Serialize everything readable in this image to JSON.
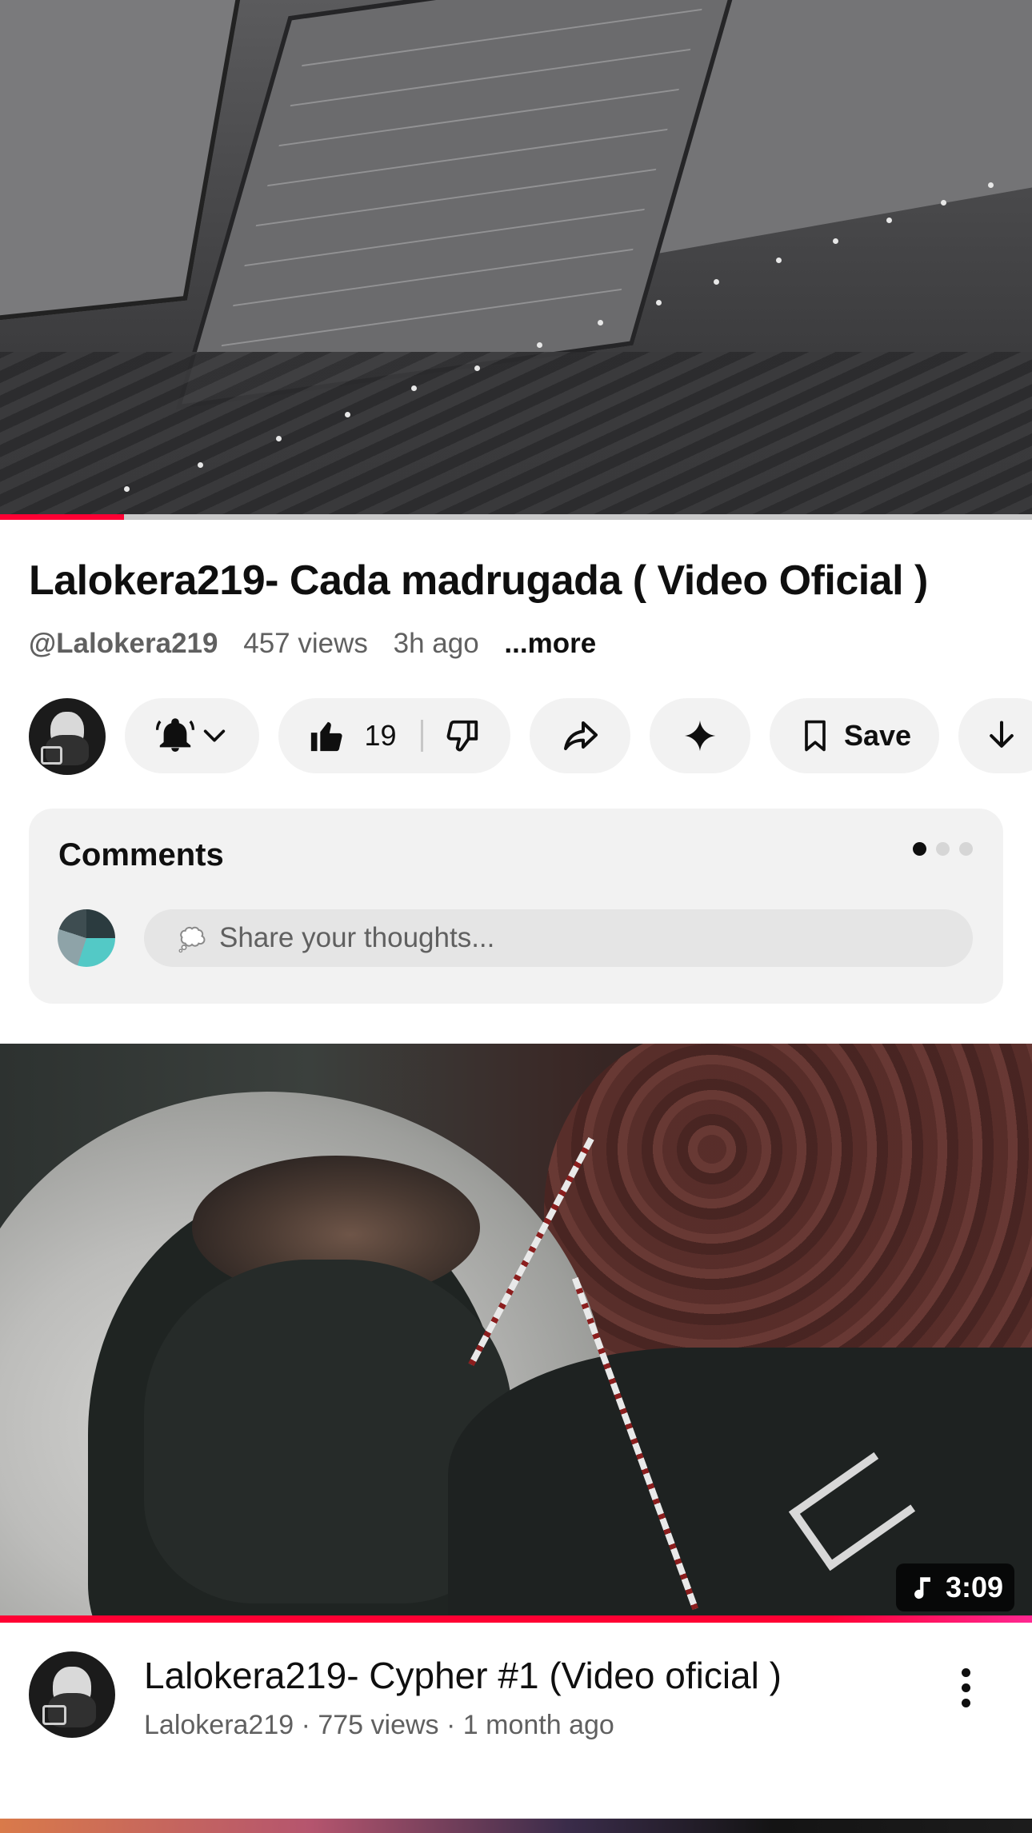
{
  "player": {
    "progress_fraction": 0.12,
    "progress_color": "#ff0033"
  },
  "video": {
    "title": "Lalokera219- Cada madrugada ( Video Oficial )",
    "handle": "@Lalokera219",
    "views": "457 views",
    "age": "3h ago",
    "more": "...more"
  },
  "actions": {
    "subscribe_icon": "bell-icon",
    "likes": "19",
    "save_label": "Save",
    "icons": [
      "thumbs-up-icon",
      "thumbs-down-icon",
      "share-icon",
      "sparkle-icon",
      "bookmark-icon",
      "download-icon"
    ]
  },
  "comments": {
    "heading": "Comments",
    "placeholder": "Share your thoughts...",
    "page_count": 3,
    "active_page": 1
  },
  "next_video": {
    "duration": "3:09",
    "title": "Lalokera219- Cypher #1 (Video oficial )",
    "channel": "Lalokera219",
    "views": "775 views",
    "age": "1 month ago",
    "meta": "Lalokera219 · 775 views · 1 month ago"
  }
}
